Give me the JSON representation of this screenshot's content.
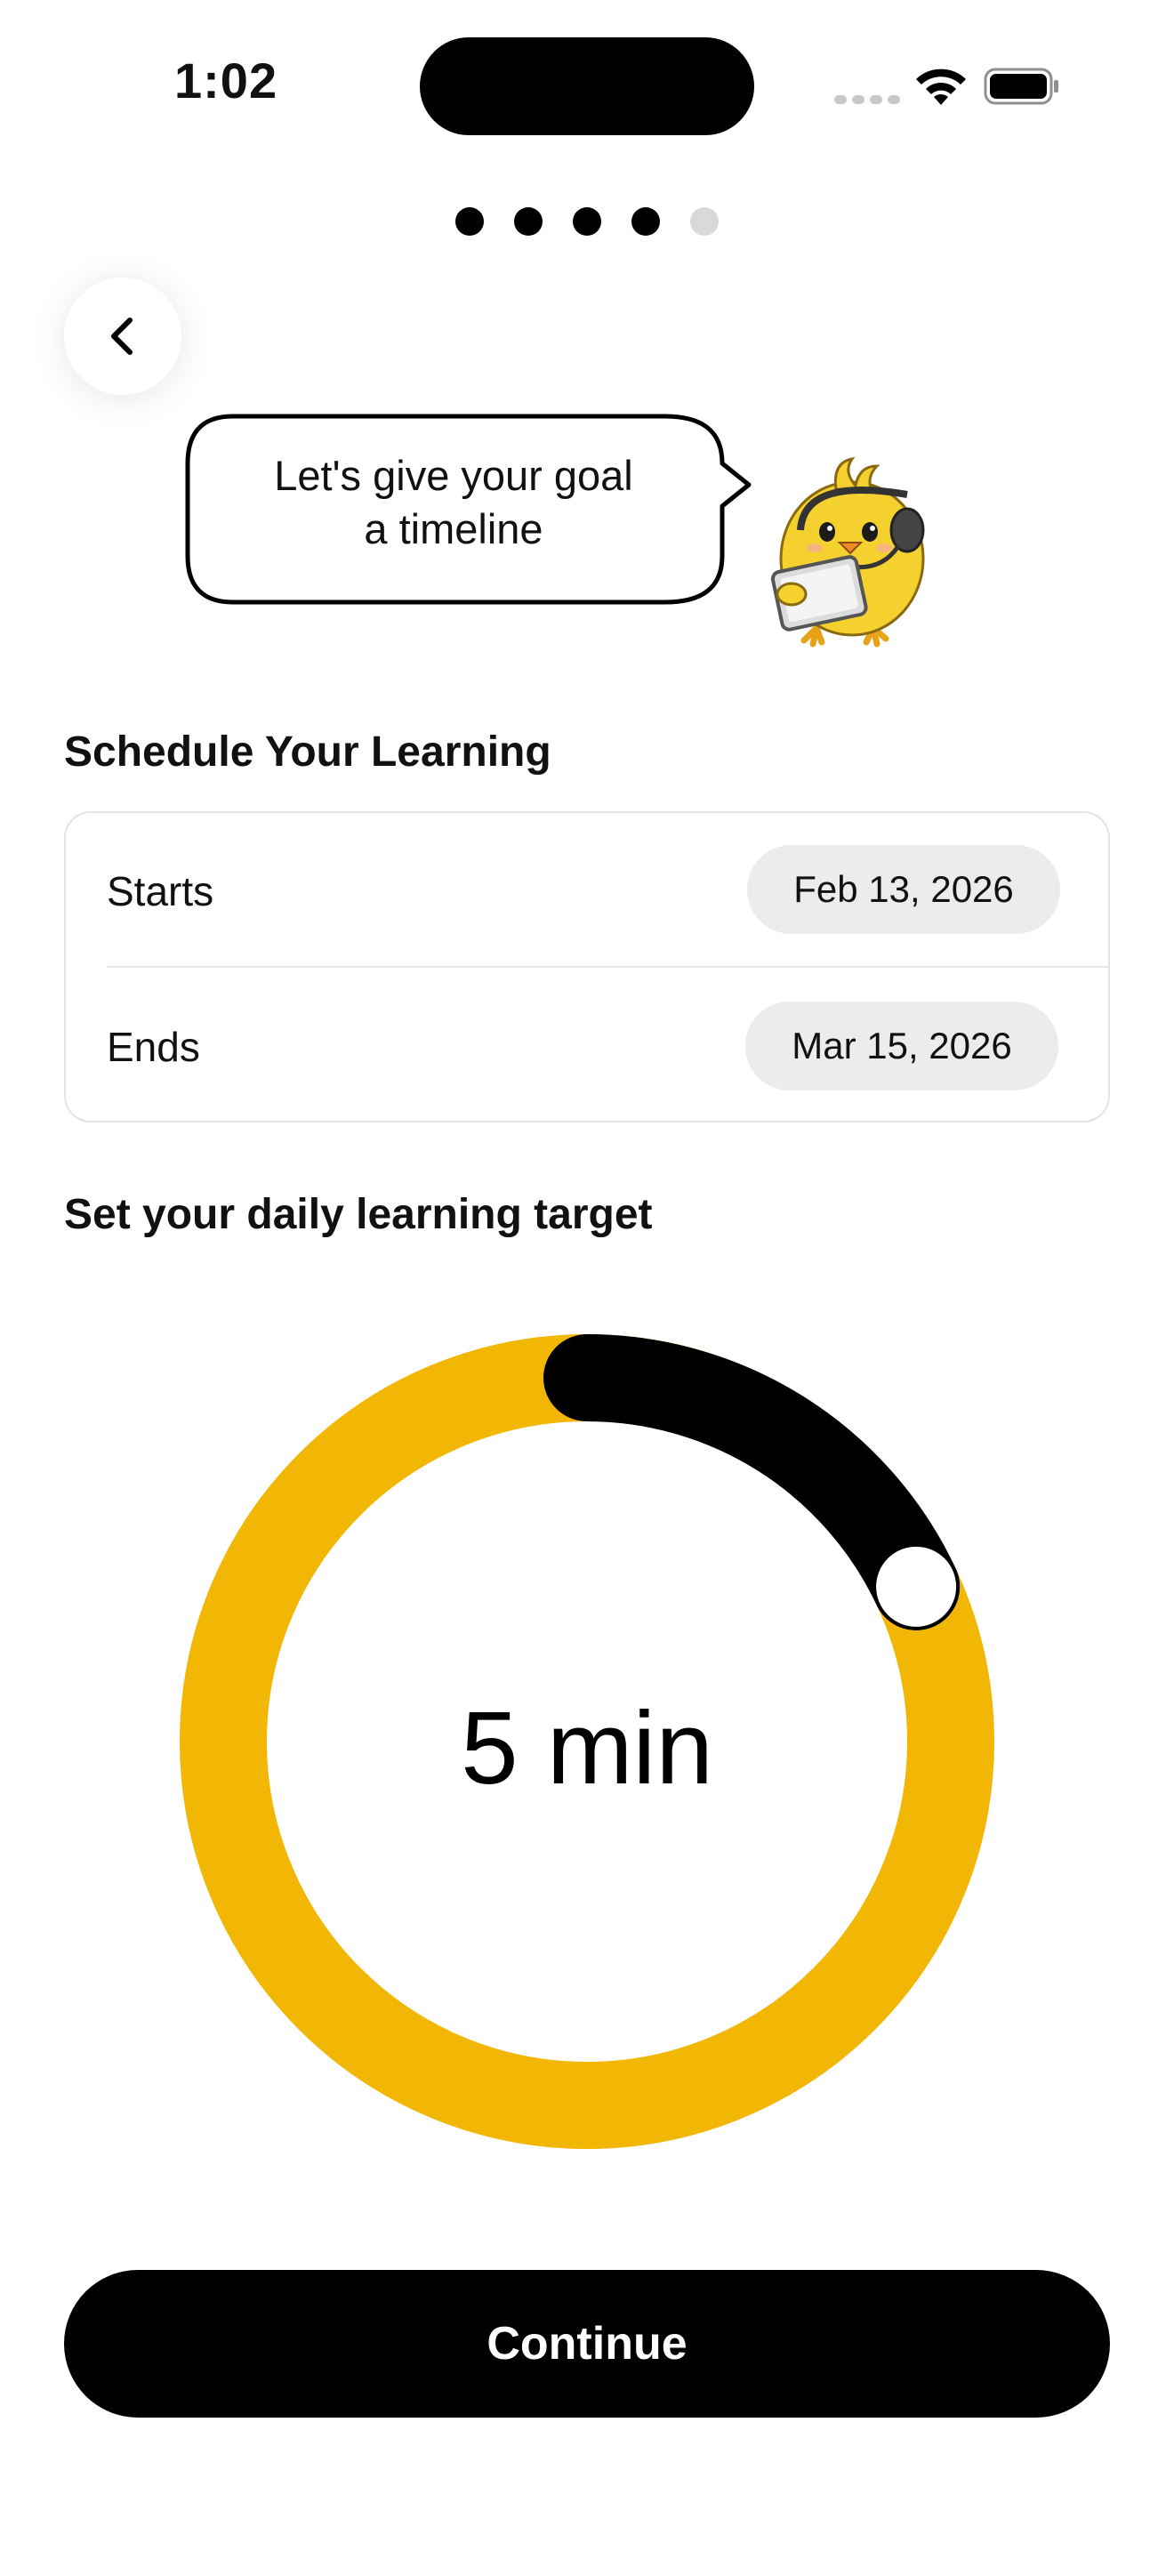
{
  "status_bar": {
    "time": "1:02"
  },
  "progress": {
    "total_steps": 5,
    "current_step": 4
  },
  "mascot": {
    "speech_line_1": "Let's give your goal",
    "speech_line_2": "a timeline",
    "icon": "chick-with-headset-and-tablet"
  },
  "schedule": {
    "title": "Schedule Your Learning",
    "starts_label": "Starts",
    "starts_value": "Feb 13, 2026",
    "ends_label": "Ends",
    "ends_value": "Mar 15, 2026"
  },
  "daily_target": {
    "title": "Set your daily learning target",
    "value_text": "5 min",
    "progress_fraction": 0.18
  },
  "cta": {
    "continue_label": "Continue"
  },
  "colors": {
    "accent": "#F2B705",
    "primary": "#000000",
    "pill_bg": "#ECECEE"
  }
}
